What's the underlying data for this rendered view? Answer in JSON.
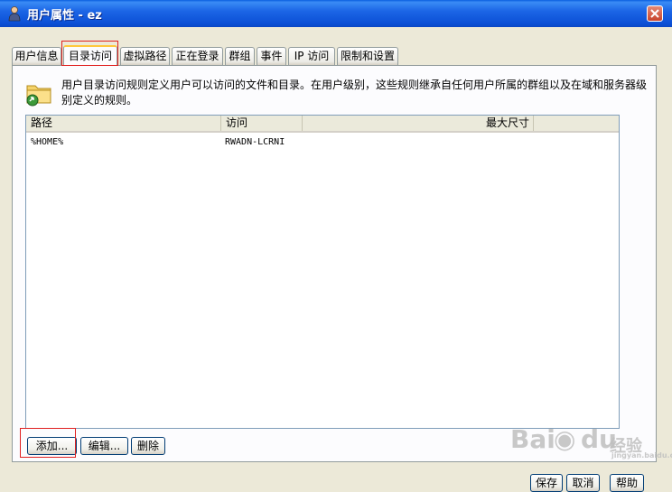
{
  "window": {
    "title": "用户属性 - ez",
    "icon": "user-icon",
    "close_icon": "close-icon"
  },
  "tabs": [
    {
      "label": "用户信息",
      "active": false
    },
    {
      "label": "目录访问",
      "active": true
    },
    {
      "label": "虚拟路径",
      "active": false
    },
    {
      "label": "正在登录",
      "active": false
    },
    {
      "label": "群组",
      "active": false
    },
    {
      "label": "事件",
      "active": false
    },
    {
      "label": "IP 访问",
      "active": false
    },
    {
      "label": "限制和设置",
      "active": false
    }
  ],
  "directory_access": {
    "icon": "folder-icon",
    "description": "用户目录访问规则定义用户可以访问的文件和目录。在用户级别，这些规则继承自任何用户所属的群组以及在域和服务器级别定义的规则。",
    "columns": [
      "路径",
      "访问",
      "最大尺寸"
    ],
    "rows": [
      {
        "path": "%HOME%",
        "access": "RWADN-LCRNI",
        "max_size": ""
      }
    ],
    "buttons": {
      "add": "添加...",
      "edit": "编辑...",
      "delete": "删除"
    }
  },
  "dialog_buttons": {
    "save": "保存",
    "cancel": "取消",
    "help": "帮助"
  },
  "watermark": {
    "brand": "Bai",
    "brand2": "du",
    "cn": "经验",
    "sub": "jingyan.baidu.com"
  },
  "colors": {
    "highlight": "#e0201f",
    "titlebar": "#0b4fd5",
    "tab_active_top": "#ffc83c"
  }
}
